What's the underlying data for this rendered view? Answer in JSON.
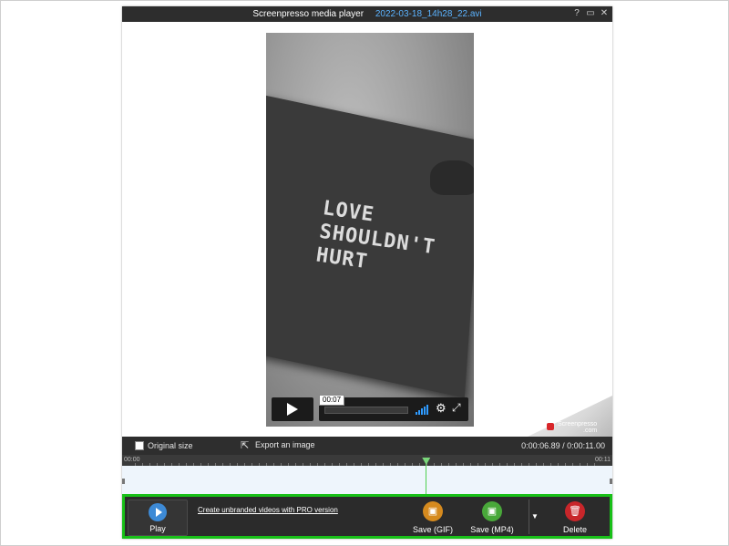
{
  "window": {
    "app_title": "Screenpresso media player",
    "file_name": "2022-03-18_14h28_22.avi",
    "help_label": "?",
    "maximize_label": "▭",
    "close_label": "✕"
  },
  "video": {
    "sign_lines": [
      "LOVE",
      "SHOULDN'T",
      "HURT"
    ],
    "time_tooltip": "00:07",
    "brand_text": "Screenpresso",
    "brand_sub": ".com"
  },
  "infobar": {
    "original_size_label": "Original size",
    "export_label": "Export an image",
    "time_readout": "0:00:06.89 / 0:00:11.00"
  },
  "timeline": {
    "start_label": "00:00",
    "end_label": "00:11",
    "playhead_fraction": 0.626
  },
  "actions": {
    "play_label": "Play",
    "pro_link": "Create unbranded videos with PRO version",
    "save_gif_label": "Save (GIF)",
    "save_mp4_label": "Save (MP4)",
    "delete_label": "Delete",
    "colors": {
      "play": "#3d8ad6",
      "save_gif": "#d58a1e",
      "save_mp4": "#49a83a",
      "delete": "#c8262a",
      "highlight": "#18c018"
    }
  },
  "icons": [
    "help-icon",
    "maximize-icon",
    "close-icon",
    "play-icon",
    "volume-icon",
    "gear-icon",
    "fullscreen-icon",
    "export-icon",
    "floppy-icon",
    "trash-icon",
    "chevron-down-icon"
  ]
}
